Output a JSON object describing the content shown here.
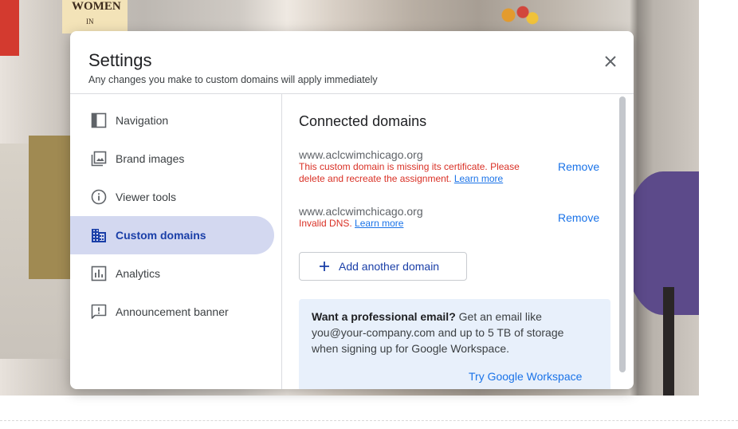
{
  "background": {
    "poster_text": "WOMEN",
    "poster_sub": "IN"
  },
  "dialog": {
    "title": "Settings",
    "subtitle": "Any changes you make to custom domains will apply immediately",
    "close_icon": "close-icon"
  },
  "sidebar": {
    "items": [
      {
        "label": "Navigation",
        "icon": "navigation-panel-icon",
        "active": false
      },
      {
        "label": "Brand images",
        "icon": "image-icon",
        "active": false
      },
      {
        "label": "Viewer tools",
        "icon": "info-icon",
        "active": false
      },
      {
        "label": "Custom domains",
        "icon": "domain-building-icon",
        "active": true
      },
      {
        "label": "Analytics",
        "icon": "bar-chart-icon",
        "active": false
      },
      {
        "label": "Announcement banner",
        "icon": "announcement-icon",
        "active": false
      }
    ]
  },
  "main": {
    "title": "Connected domains",
    "domains": [
      {
        "name": "www.aclcwimchicago.org",
        "error": "This custom domain is missing its certificate. Please delete and recreate the assignment.",
        "learn_more": "Learn more",
        "remove": "Remove"
      },
      {
        "name": "www.aclcwimchicago.org",
        "error": "Invalid DNS.",
        "learn_more": "Learn more",
        "remove": "Remove"
      }
    ],
    "add_button": "Add another domain",
    "promo": {
      "bold": "Want a professional email?",
      "text": " Get an email like you@your-company.com and up to 5 TB of storage when signing up for Google Workspace.",
      "link": "Try Google Workspace"
    }
  },
  "colors": {
    "accent": "#1a73e8",
    "active_nav_bg": "#d3d8f0",
    "error": "#d93025",
    "promo_bg": "#e8f0fb"
  }
}
